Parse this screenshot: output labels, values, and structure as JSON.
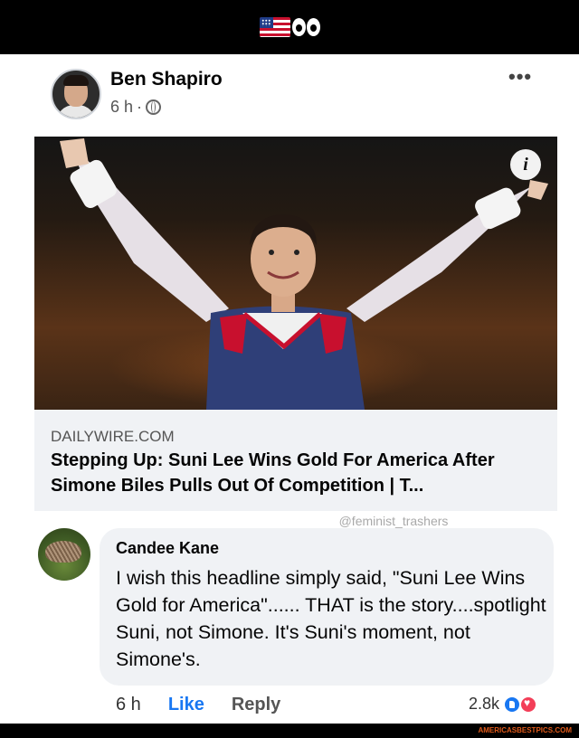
{
  "post": {
    "author": "Ben Shapiro",
    "time": "6 h",
    "more_label": "•••"
  },
  "link": {
    "domain": "DAILYWIRE.COM",
    "headline": "Stepping Up: Suni Lee Wins Gold For America After Simone Biles Pulls Out Of Competition | T..."
  },
  "watermark": "@feminist_trashers",
  "comment": {
    "author": "Candee Kane",
    "text": "I wish this headline simply said, \"Suni Lee Wins Gold for America\"...... THAT is the story....spotlight Suni, not Simone. It's Suni's moment, not Simone's.",
    "time": "6 h",
    "like_label": "Like",
    "reply_label": "Reply",
    "reaction_count": "2.8k"
  },
  "footer": {
    "site": "AMERICASBESTPICS.COM"
  },
  "icons": {
    "header": [
      "us-flag-icon",
      "eyes-icon"
    ],
    "privacy": "globe-icon",
    "info": "info-icon",
    "reactions": [
      "like-reaction-icon",
      "love-reaction-icon"
    ]
  },
  "colors": {
    "accent": "#1877f2",
    "love": "#f33e58",
    "bubble": "#f0f2f5"
  }
}
